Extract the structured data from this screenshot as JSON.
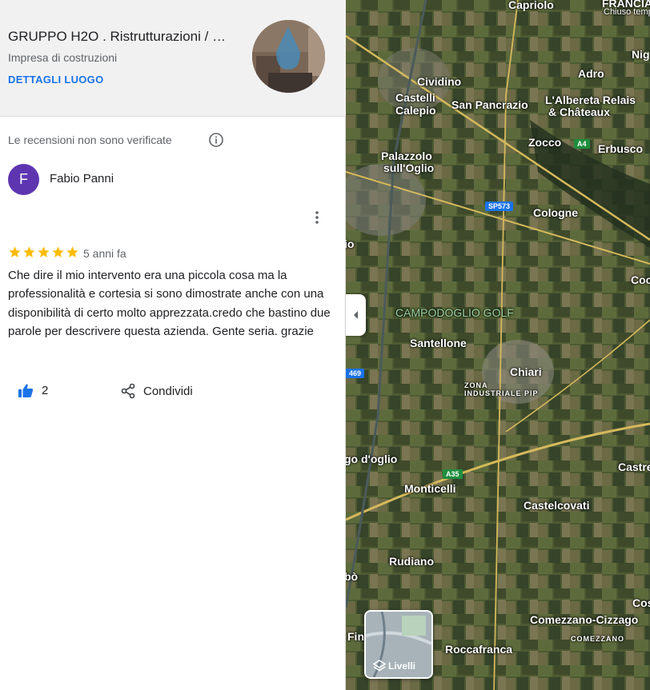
{
  "place": {
    "name": "GRUPPO H2O . Ristrutturazioni / …",
    "type": "Impresa di costruzioni",
    "details_link": "DETTAGLI LUOGO"
  },
  "reviews_notice": "Le recensioni non sono verificate",
  "review": {
    "avatar_letter": "F",
    "author": "Fabio Panni",
    "rating": 5,
    "age": "5 anni fa",
    "text": "Che dire il mio intervento era una piccola cosa ma la professionalità e cortesia si sono dimostrate anche con una disponibilità di certo molto apprezzata.credo che bastino due parole per descrivere questa azienda. Gente seria. grazie",
    "likes": "2",
    "share_label": "Condividi"
  },
  "map": {
    "layers_label": "Livelli",
    "places": [
      {
        "name": "Capriolo",
        "cls": ""
      },
      {
        "name": "FRANCIA",
        "cls": ""
      },
      {
        "name": "Chiuso temporaneamente",
        "cls": "small"
      },
      {
        "name": "Nig",
        "cls": ""
      },
      {
        "name": "Adro",
        "cls": ""
      },
      {
        "name": "Cividino",
        "cls": ""
      },
      {
        "name": "Castelli",
        "cls": ""
      },
      {
        "name": "Calepio",
        "cls": ""
      },
      {
        "name": "San Pancrazio",
        "cls": ""
      },
      {
        "name": "L'Albereta Relais",
        "cls": ""
      },
      {
        "name": "& Châteaux",
        "cls": ""
      },
      {
        "name": "Zocco",
        "cls": ""
      },
      {
        "name": "Erbusco",
        "cls": ""
      },
      {
        "name": "Palazzolo",
        "cls": ""
      },
      {
        "name": "sull'Oglio",
        "cls": ""
      },
      {
        "name": "Cologne",
        "cls": ""
      },
      {
        "name": "io",
        "cls": ""
      },
      {
        "name": "Coccagl",
        "cls": ""
      },
      {
        "name": "CAMPODOGLIO GOLF",
        "cls": "golf"
      },
      {
        "name": "Santellone",
        "cls": ""
      },
      {
        "name": "Chiari",
        "cls": ""
      },
      {
        "name": "ZONA",
        "cls": "tiny"
      },
      {
        "name": "INDUSTRIALE PIP",
        "cls": "tiny"
      },
      {
        "name": "go d'oglio",
        "cls": ""
      },
      {
        "name": "Castre",
        "cls": ""
      },
      {
        "name": "Monticelli",
        "cls": ""
      },
      {
        "name": "Castelcovati",
        "cls": ""
      },
      {
        "name": "Rudiano",
        "cls": ""
      },
      {
        "name": "bò",
        "cls": ""
      },
      {
        "name": "Cos",
        "cls": ""
      },
      {
        "name": "Comezzano-Cizzago",
        "cls": ""
      },
      {
        "name": "COMEZZANO",
        "cls": "tiny"
      },
      {
        "name": "Fin",
        "cls": ""
      },
      {
        "name": "Roccafranca",
        "cls": ""
      }
    ],
    "shields": [
      {
        "text": "A4",
        "color": "#1e8e3e"
      },
      {
        "text": "SP573",
        "color": "#1a73e8"
      },
      {
        "text": "469",
        "color": "#1a73e8"
      },
      {
        "text": "A35",
        "color": "#1e8e3e"
      }
    ]
  }
}
